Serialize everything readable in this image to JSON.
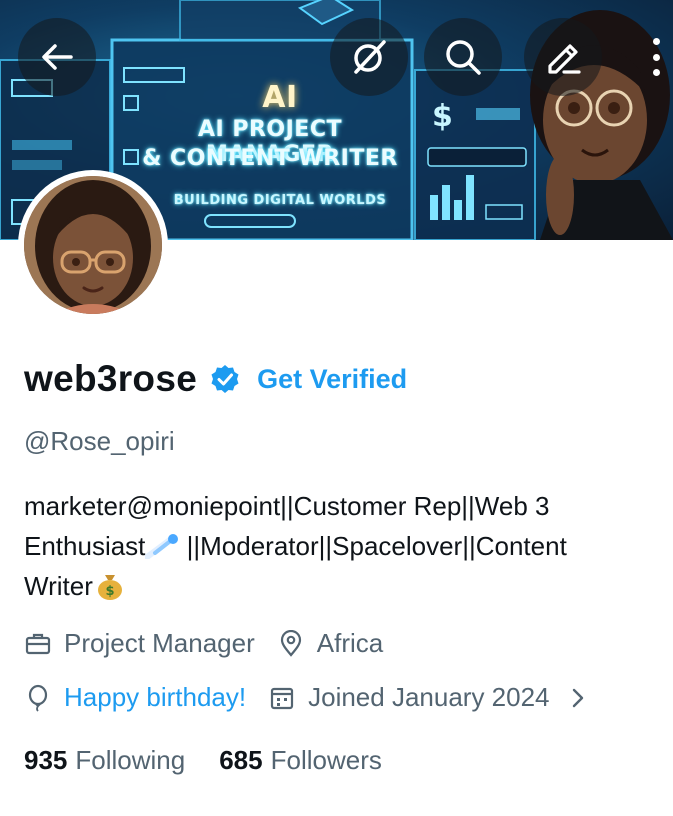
{
  "banner": {
    "headline_ai": "AI",
    "headline_line1": "AI PROJECT MANAGER",
    "headline_line2": "& CONTENT WRITER",
    "subline": "BUILDING DIGITAL WORLDS"
  },
  "toolbar": {
    "back_icon": "arrow-left-icon",
    "grok_icon": "grok-slash-icon",
    "search_icon": "search-icon",
    "edit_icon": "pencil-icon",
    "more_icon": "more-vertical-icon"
  },
  "profile": {
    "display_name": "web3rose",
    "get_verified": "Get Verified",
    "handle": "@Rose_opiri",
    "bio_line1": "marketer@moniepoint||Customer Rep||Web 3",
    "bio_line2_a": "Enthusiast",
    "bio_line2_b": " ||Moderator||Spacelover||Content",
    "bio_line3": "Writer",
    "profession": "Project Manager",
    "location": "Africa",
    "birthday": "Happy birthday!",
    "joined": "Joined January 2024",
    "following_count": "935",
    "following_label": "Following",
    "followers_count": "685",
    "followers_label": "Followers"
  },
  "colors": {
    "accent": "#1d9bf0",
    "text_primary": "#0f1419",
    "text_secondary": "#536471"
  }
}
